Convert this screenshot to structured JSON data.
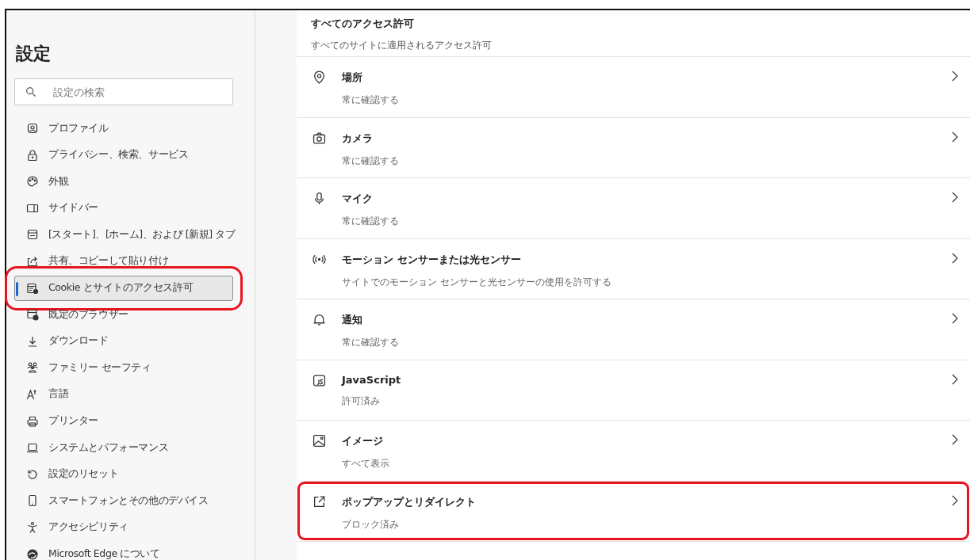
{
  "sidebar": {
    "title": "設定",
    "search": {
      "placeholder": "設定の検索"
    },
    "items": [
      {
        "label": "プロファイル",
        "selected": false,
        "highlighted": false
      },
      {
        "label": "プライバシー、検索、サービス",
        "selected": false,
        "highlighted": false
      },
      {
        "label": "外観",
        "selected": false,
        "highlighted": false
      },
      {
        "label": "サイドバー",
        "selected": false,
        "highlighted": false
      },
      {
        "label": "[スタート]、[ホーム]、および [新規] タブ",
        "selected": false,
        "highlighted": false
      },
      {
        "label": "共有、コピーして貼り付け",
        "selected": false,
        "highlighted": false
      },
      {
        "label": "Cookie とサイトのアクセス許可",
        "selected": true,
        "highlighted": true
      },
      {
        "label": "既定のブラウザー",
        "selected": false,
        "highlighted": false
      },
      {
        "label": "ダウンロード",
        "selected": false,
        "highlighted": false
      },
      {
        "label": "ファミリー セーフティ",
        "selected": false,
        "highlighted": false
      },
      {
        "label": "言語",
        "selected": false,
        "highlighted": false
      },
      {
        "label": "プリンター",
        "selected": false,
        "highlighted": false
      },
      {
        "label": "システムとパフォーマンス",
        "selected": false,
        "highlighted": false
      },
      {
        "label": "設定のリセット",
        "selected": false,
        "highlighted": false
      },
      {
        "label": "スマートフォンとその他のデバイス",
        "selected": false,
        "highlighted": false
      },
      {
        "label": "アクセシビリティ",
        "selected": false,
        "highlighted": false
      },
      {
        "label": "Microsoft Edge について",
        "selected": false,
        "highlighted": false
      }
    ]
  },
  "content": {
    "title": "すべてのアクセス許可",
    "subtitle": "すべてのサイトに適用されるアクセス許可",
    "rows": [
      {
        "title": "場所",
        "value": "常に確認する",
        "highlighted": false
      },
      {
        "title": "カメラ",
        "value": "常に確認する",
        "highlighted": false
      },
      {
        "title": "マイク",
        "value": "常に確認する",
        "highlighted": false
      },
      {
        "title": "モーション センサーまたは光センサー",
        "value": "サイトでのモーション センサーと光センサーの使用を許可する",
        "highlighted": false
      },
      {
        "title": "通知",
        "value": "常に確認する",
        "highlighted": false
      },
      {
        "title": "JavaScript",
        "value": "許可済み",
        "highlighted": false
      },
      {
        "title": "イメージ",
        "value": "すべて表示",
        "highlighted": false
      },
      {
        "title": "ポップアップとリダイレクト",
        "value": "ブロック済み",
        "highlighted": true
      }
    ]
  }
}
